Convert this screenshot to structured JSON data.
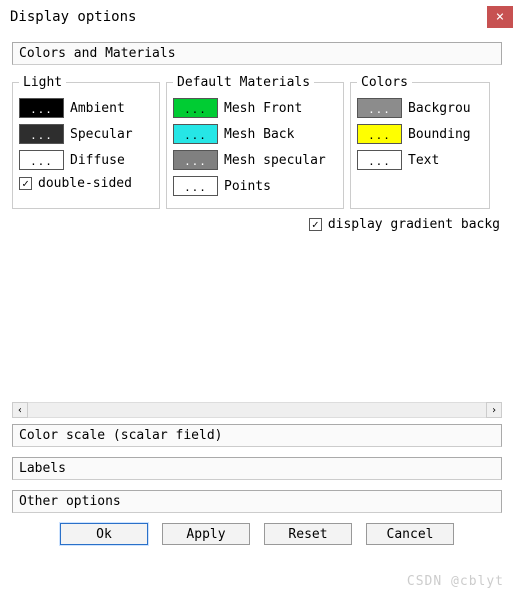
{
  "window": {
    "title": "Display options",
    "close_glyph": "×"
  },
  "sections": {
    "colors_materials": "Colors and Materials",
    "color_scale": "Color scale (scalar field)",
    "labels": "Labels",
    "other": "Other options"
  },
  "groups": {
    "light": {
      "legend": "Light",
      "items": [
        {
          "label": "Ambient",
          "color": "#000000",
          "dots": "dark"
        },
        {
          "label": "Specular",
          "color": "#2e2e2e",
          "dots": "dark"
        },
        {
          "label": "Diffuse",
          "color": "#ffffff",
          "dots": "light"
        }
      ],
      "double_sided": {
        "label": "double-sided",
        "checked": true
      }
    },
    "materials": {
      "legend": "Default Materials",
      "items": [
        {
          "label": "Mesh Front",
          "color": "#00cc33",
          "dots": "light"
        },
        {
          "label": "Mesh Back",
          "color": "#26e6e6",
          "dots": "light"
        },
        {
          "label": "Mesh specular",
          "color": "#808080",
          "dots": "dark"
        },
        {
          "label": "Points",
          "color": "#ffffff",
          "dots": "light"
        }
      ]
    },
    "colors": {
      "legend": "Colors",
      "items": [
        {
          "label": "Backgrou",
          "color": "#8c8c8c",
          "dots": "dark"
        },
        {
          "label": "Bounding",
          "color": "#ffff00",
          "dots": "light"
        },
        {
          "label": "Text",
          "color": "#ffffff",
          "dots": "light"
        }
      ]
    }
  },
  "gradient_check": {
    "label": "display gradient backg",
    "checked": true
  },
  "buttons": {
    "ok": "Ok",
    "apply": "Apply",
    "reset": "Reset",
    "cancel": "Cancel"
  },
  "dots": "...",
  "checkmark": "✓",
  "scroll": {
    "left": "‹",
    "right": "›"
  },
  "watermark": "CSDN @cblyt"
}
